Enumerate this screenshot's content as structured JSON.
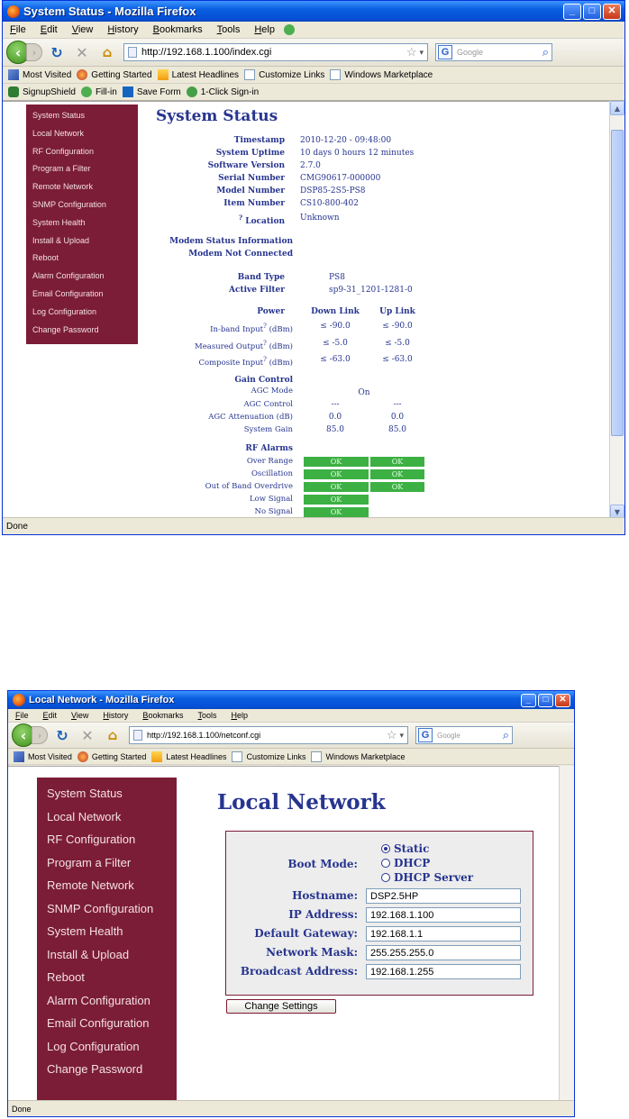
{
  "menu": [
    "File",
    "Edit",
    "View",
    "History",
    "Bookmarks",
    "Tools",
    "Help"
  ],
  "bookmarks": [
    "Most Visited",
    "Getting Started",
    "Latest Headlines",
    "Customize Links",
    "Windows Marketplace"
  ],
  "toolbar2": [
    "SignupShield",
    "Fill-in",
    "Save Form",
    "1-Click Sign-in"
  ],
  "search_placeholder": "Google",
  "status_text": "Done",
  "nav_links": [
    "System Status",
    "Local Network",
    "RF Configuration",
    "Program a Filter",
    "Remote Network",
    "SNMP Configuration",
    "System Health",
    "Install & Upload",
    "Reboot",
    "Alarm Configuration",
    "Email Configuration",
    "Log Configuration",
    "Change Password"
  ],
  "win1": {
    "title": "System Status - Mozilla Firefox",
    "url": "http://192.168.1.100/index.cgi",
    "page_title": "System Status",
    "info_rows": [
      {
        "label": "Timestamp",
        "value": "2010-12-20 - 09:48:00"
      },
      {
        "label": "System Uptime",
        "value": "10 days 0 hours 12 minutes"
      },
      {
        "label": "Software Version",
        "value": "2.7.0"
      },
      {
        "label": "Serial Number",
        "value": "CMG90617-000000"
      },
      {
        "label": "Model Number",
        "value": "DSP85-2S5-PS8"
      },
      {
        "label": "Item Number",
        "value": "CS10-800-402"
      },
      {
        "label": "Location",
        "value": "Unknown",
        "help": "?"
      }
    ],
    "modem_head": "Modem Status Information",
    "modem_state": "Modem Not Connected",
    "band_rows": [
      {
        "label": "Band Type",
        "value": "PS8"
      },
      {
        "label": "Active Filter",
        "value": "sp9-31_1201-1281-0"
      }
    ],
    "power": {
      "head": "Power",
      "col_down": "Down Link",
      "col_up": "Up Link",
      "rows": [
        {
          "label": "In-band Input",
          "help": "?",
          "unit": "(dBm)",
          "down": "≤ -90.0",
          "up": "≤ -90.0"
        },
        {
          "label": "Measured Output",
          "help": "?",
          "unit": "(dBm)",
          "down": "≤ -5.0",
          "up": "≤ -5.0"
        },
        {
          "label": "Composite Input",
          "help": "?",
          "unit": "(dBm)",
          "down": "≤ -63.0",
          "up": "≤ -63.0"
        }
      ]
    },
    "gain": {
      "head": "Gain Control",
      "mode_label": "AGC Mode",
      "mode_value": "On",
      "rows": [
        {
          "label": "AGC Control",
          "down": "---",
          "up": "---"
        },
        {
          "label": "AGC Attenuation (dB)",
          "down": "0.0",
          "up": "0.0"
        },
        {
          "label": "System Gain",
          "down": "85.0",
          "up": "85.0"
        }
      ]
    },
    "alarms": {
      "head": "RF Alarms",
      "rows": [
        {
          "label": "Over Range",
          "down": "OK",
          "up": "OK"
        },
        {
          "label": "Oscillation",
          "down": "OK",
          "up": "OK"
        },
        {
          "label": "Out of Band Overdrive",
          "down": "OK",
          "up": "OK"
        },
        {
          "label": "Low Signal",
          "down": "OK"
        },
        {
          "label": "No Signal",
          "down": "OK"
        }
      ]
    }
  },
  "win2": {
    "title": "Local Network - Mozilla Firefox",
    "url": "http://192.168.1.100/netconf.cgi",
    "page_title": "Local Network",
    "boot_label": "Boot Mode:",
    "boot_options": [
      "Static",
      "DHCP",
      "DHCP Server"
    ],
    "boot_selected": "Static",
    "fields": [
      {
        "label": "Hostname:",
        "value": "DSP2.5HP"
      },
      {
        "label": "IP Address:",
        "value": "192.168.1.100"
      },
      {
        "label": "Default Gateway:",
        "value": "192.168.1.1"
      },
      {
        "label": "Network Mask:",
        "value": "255.255.255.0"
      },
      {
        "label": "Broadcast Address:",
        "value": "192.168.1.255"
      }
    ],
    "submit_label": "Change Settings"
  },
  "colors": {
    "nav_bg": "#7b1d36",
    "heading": "#27358f",
    "alarm_ok": "#3cb043",
    "titlebar": "#0a5fe0"
  }
}
